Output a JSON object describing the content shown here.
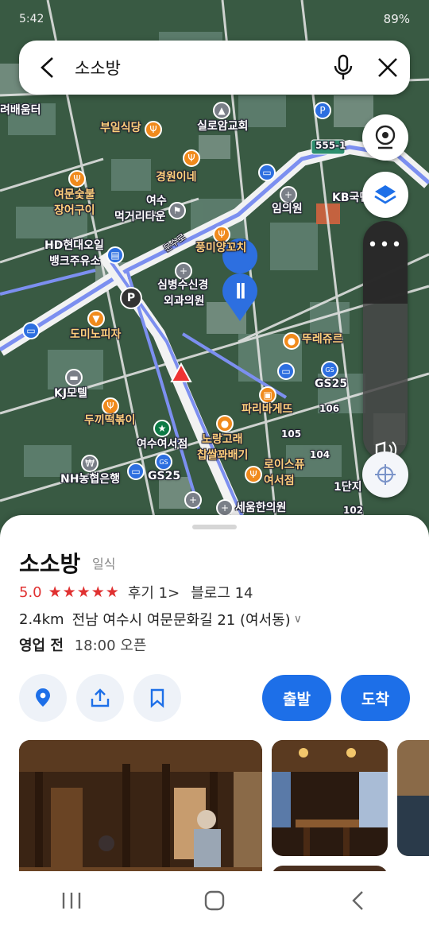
{
  "status_bar": {
    "time": "5:42",
    "battery": "89%"
  },
  "search": {
    "query": "소소방"
  },
  "map": {
    "road_shield": "555-1",
    "labels": [
      "부일식당",
      "실로암교회",
      "경원이네",
      "여문숯불",
      "장어구이",
      "여수",
      "먹거리타운",
      "임의원",
      "KB국민",
      "HD현대오일",
      "뱅크주유소",
      "풍미양꼬치",
      "심병수신경",
      "외과의원",
      "도미노피자",
      "뚜레쥬르",
      "KJ모텔",
      "GS25",
      "파리바게뜨",
      "두끼떡볶이",
      "여수여서점",
      "노랑고래",
      "찹쌀꽈배기",
      "로이스퓨",
      "여서점",
      "NH농협은행",
      "GS25",
      "세움한의원",
      "려배움터",
      "1단지",
      "105",
      "106",
      "104",
      "102",
      "문수로"
    ]
  },
  "place": {
    "name": "소소방",
    "category": "일식",
    "rating": "5.0",
    "stars": "★★★★★",
    "review_label": "후기 1",
    "review_chevron": ">",
    "blog_label": "블로그 14",
    "distance": "2.4km",
    "address": "전남 여수시 여문문화길 21 (여서동)",
    "hours_status": "영업 전",
    "hours_time": "18:00 오픈"
  },
  "actions": {
    "depart_label": "출발",
    "arrive_label": "도착"
  },
  "colors": {
    "accent": "#1d6fe8",
    "rating": "#e03131",
    "route": "#7c8ff0"
  }
}
